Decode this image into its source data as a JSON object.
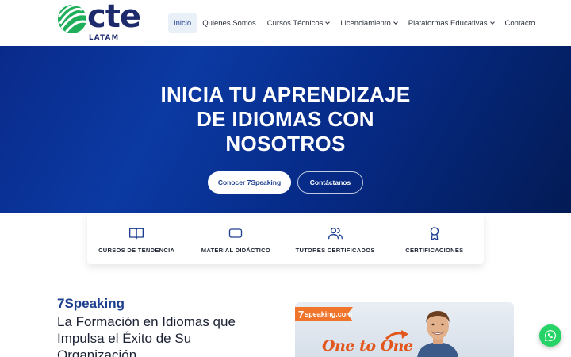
{
  "brand": {
    "logo_word": "cte",
    "logo_sub": "LATAM"
  },
  "nav": {
    "items": [
      {
        "label": "Inicio",
        "active": true,
        "has_dropdown": false
      },
      {
        "label": "Quienes Somos",
        "active": false,
        "has_dropdown": false
      },
      {
        "label": "Cursos Técnicos",
        "active": false,
        "has_dropdown": true
      },
      {
        "label": "Licenciamiento",
        "active": false,
        "has_dropdown": true
      },
      {
        "label": "Plataformas Educativas",
        "active": false,
        "has_dropdown": true
      },
      {
        "label": "Contacto",
        "active": false,
        "has_dropdown": false
      }
    ]
  },
  "hero": {
    "title_lines": [
      "INICIA TU APRENDIZAJE",
      "DE IDIOMAS CON",
      "NOSOTROS"
    ],
    "primary_button": "Conocer 7Speaking",
    "secondary_button": "Contáctanos"
  },
  "features": [
    {
      "label": "CURSOS DE TENDENCIA",
      "icon": "book-icon"
    },
    {
      "label": "MATERIAL DIDÁCTICO",
      "icon": "tablet-icon"
    },
    {
      "label": "TUTORES CERTIFICADOS",
      "icon": "users-icon"
    },
    {
      "label": "CERTIFICACIONES",
      "icon": "award-icon"
    }
  ],
  "content": {
    "brand_title": "7Speaking",
    "heading": "La Formación en Idiomas que Impulsa el Éxito de Su Organización"
  },
  "promo": {
    "badge_number": "7",
    "badge_text": "speaking.com",
    "text": "One to One"
  },
  "colors": {
    "accent": "#1d3f8f",
    "hero_dark": "#031b55",
    "promo_orange": "#f0742a",
    "whatsapp": "#25d366"
  }
}
